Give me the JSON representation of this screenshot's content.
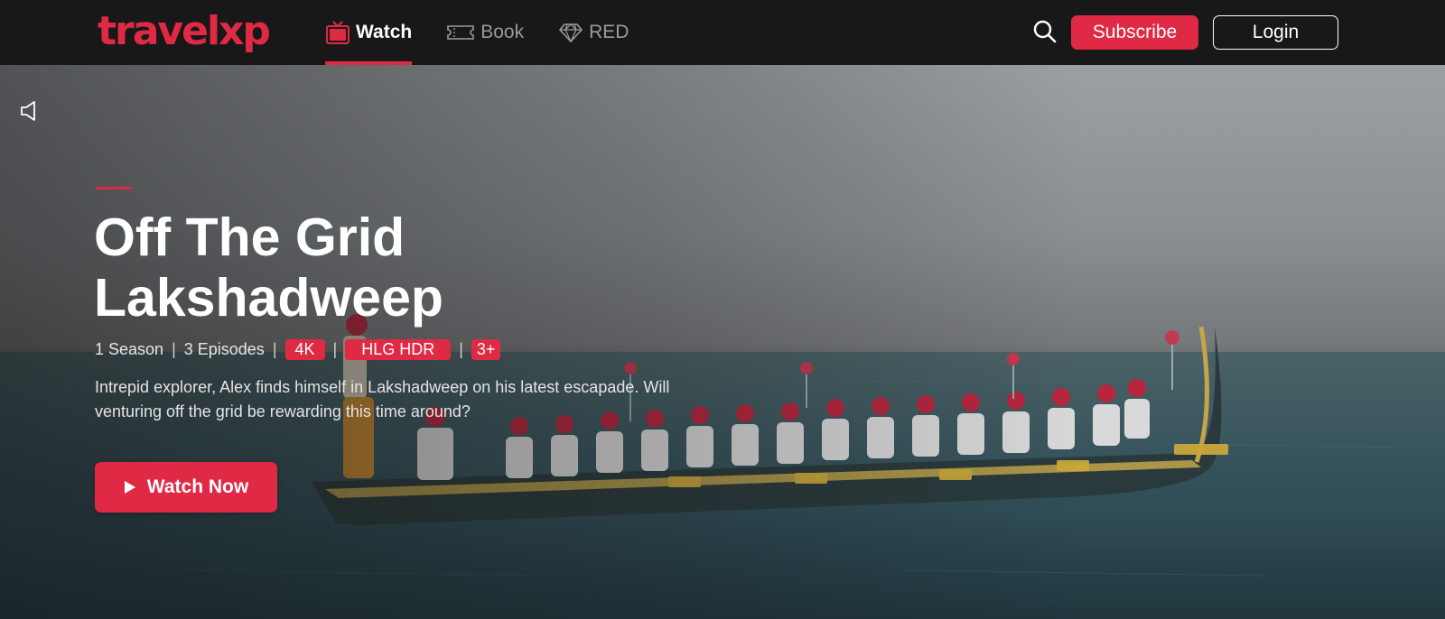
{
  "brand": {
    "logo_text": "travelxp",
    "accent_color": "#e02a45"
  },
  "nav": {
    "items": [
      {
        "label": "Watch",
        "icon": "tv-icon",
        "active": true
      },
      {
        "label": "Book",
        "icon": "ticket-icon",
        "active": false
      },
      {
        "label": "RED",
        "icon": "diamond-icon",
        "active": false
      }
    ]
  },
  "header": {
    "search_icon": "search-icon",
    "subscribe_label": "Subscribe",
    "login_label": "Login"
  },
  "hero": {
    "mute_icon": "speaker-icon",
    "title_line1": "Off The Grid",
    "title_line2": "Lakshadweep",
    "seasons": "1 Season",
    "episodes": "3 Episodes",
    "badges": [
      "4K",
      "HLG HDR",
      "3+"
    ],
    "description": "Intrepid explorer, Alex finds himself in Lakshadweep on his latest escapade. Will venturing off the grid be rewarding this time around?",
    "cta_label": "Watch Now",
    "cta_icon": "play-icon"
  }
}
